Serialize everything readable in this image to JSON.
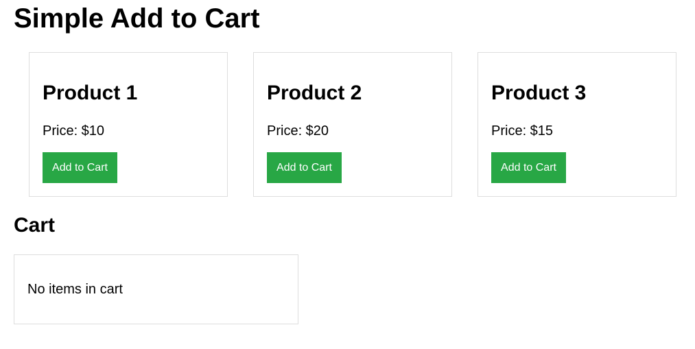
{
  "page": {
    "title": "Simple Add to Cart"
  },
  "products": [
    {
      "name": "Product 1",
      "price": "Price: $10",
      "button_label": "Add to Cart"
    },
    {
      "name": "Product 2",
      "price": "Price: $20",
      "button_label": "Add to Cart"
    },
    {
      "name": "Product 3",
      "price": "Price: $15",
      "button_label": "Add to Cart"
    }
  ],
  "cart": {
    "heading": "Cart",
    "empty_message": "No items in cart"
  },
  "colors": {
    "button_background": "#28a745",
    "button_text": "#ffffff",
    "card_border": "#dddddd"
  }
}
